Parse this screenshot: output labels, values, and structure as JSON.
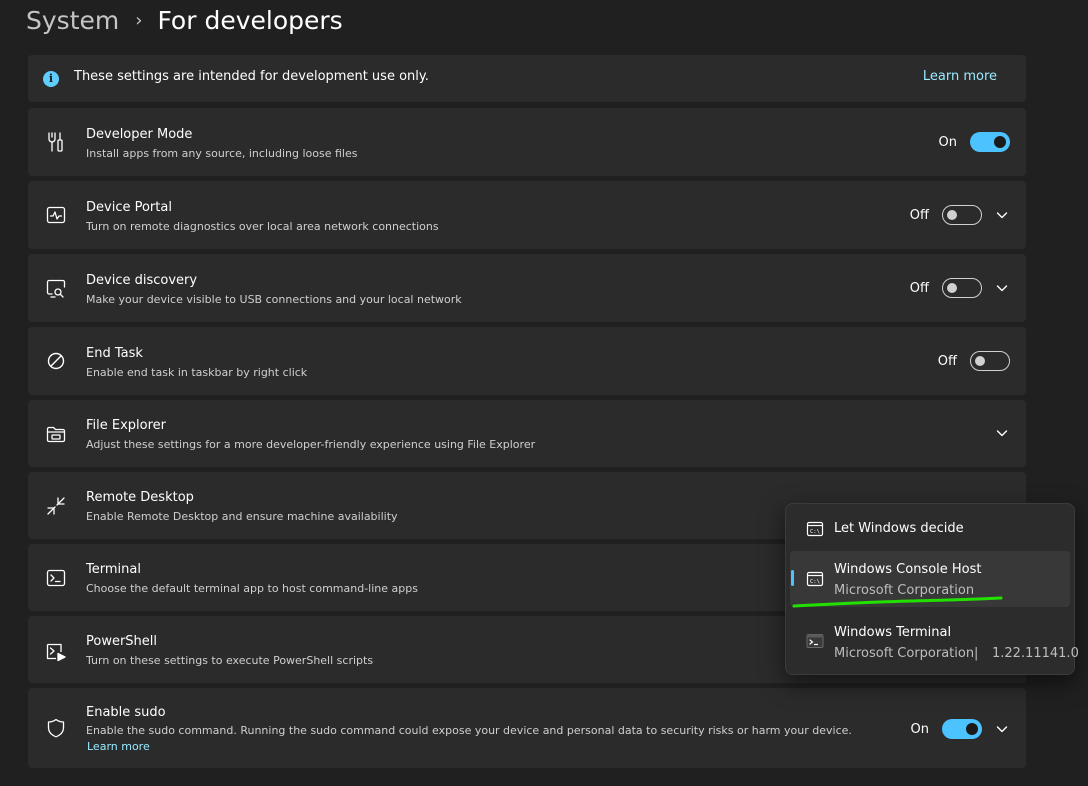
{
  "breadcrumb": {
    "parent": "System",
    "separator": "›",
    "current": "For developers"
  },
  "info": {
    "text": "These settings are intended for development use only.",
    "link": "Learn more"
  },
  "rows": [
    {
      "id": "developer-mode",
      "icon": "developer-tools-icon",
      "title": "Developer Mode",
      "subtitle": "Install apps from any source, including loose files",
      "state": "On"
    },
    {
      "id": "device-portal",
      "icon": "device-portal-icon",
      "title": "Device Portal",
      "subtitle": "Turn on remote diagnostics over local area network connections",
      "state": "Off"
    },
    {
      "id": "device-discovery",
      "icon": "device-discovery-icon",
      "title": "Device discovery",
      "subtitle": "Make your device visible to USB connections and your local network",
      "state": "Off"
    },
    {
      "id": "end-task",
      "icon": "block-icon",
      "title": "End Task",
      "subtitle": "Enable end task in taskbar by right click",
      "state": "Off"
    },
    {
      "id": "file-explorer",
      "icon": "folder-icon",
      "title": "File Explorer",
      "subtitle": "Adjust these settings for a more developer-friendly experience using File Explorer"
    },
    {
      "id": "remote-desktop",
      "icon": "remote-desktop-icon",
      "title": "Remote Desktop",
      "subtitle": "Enable Remote Desktop and ensure machine availability"
    },
    {
      "id": "terminal",
      "icon": "terminal-icon",
      "title": "Terminal",
      "subtitle": "Choose the default terminal app to host command-line apps"
    },
    {
      "id": "powershell",
      "icon": "powershell-icon",
      "title": "PowerShell",
      "subtitle": "Turn on these settings to execute PowerShell scripts"
    },
    {
      "id": "enable-sudo",
      "icon": "shield-icon",
      "title": "Enable sudo",
      "subtitle": "Enable the sudo command. Running the sudo command could expose your device and personal data to security risks or harm your device.",
      "link": "Learn more",
      "state": "On"
    }
  ],
  "terminal_menu": {
    "selected": "Windows Console Host",
    "options": [
      {
        "icon": "console-host-icon",
        "title": "Let Windows decide"
      },
      {
        "icon": "console-host-icon",
        "title": "Windows Console Host",
        "subtitle": "Microsoft Corporation"
      },
      {
        "icon": "windows-terminal-icon",
        "title": "Windows Terminal",
        "subtitle": "Microsoft Corporation",
        "separator": "|",
        "version": "1.22.11141.0"
      }
    ]
  },
  "colors": {
    "accent": "#4cc2ff",
    "link": "#99ebff",
    "annotation": "#22e000",
    "card": "#2b2b2b",
    "background": "#202020"
  }
}
